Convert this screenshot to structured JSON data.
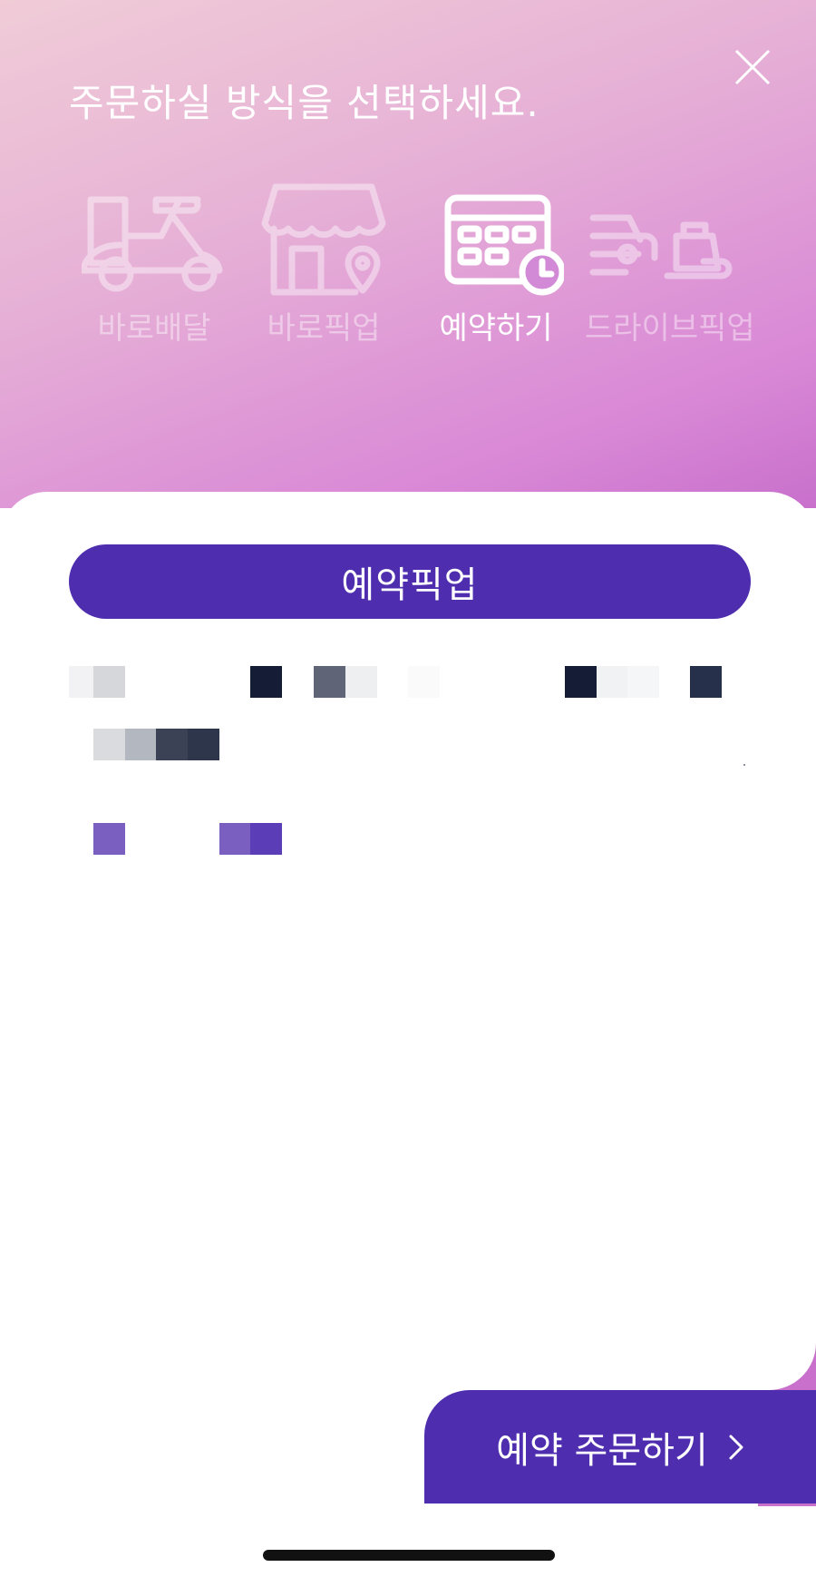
{
  "header": {
    "title": "주문하실 방식을 선택하세요."
  },
  "modes": [
    {
      "label": "바로배달",
      "icon": "scooter-icon",
      "active": false
    },
    {
      "label": "바로픽업",
      "icon": "store-pin-icon",
      "active": false
    },
    {
      "label": "예약하기",
      "icon": "calendar-clock-icon",
      "active": true
    },
    {
      "label": "드라이브픽업",
      "icon": "drive-pickup-icon",
      "active": false
    }
  ],
  "selected_option": {
    "label": "예약픽업"
  },
  "cta": {
    "label": "예약 주문하기",
    "icon": "chevron-right-icon"
  },
  "colors": {
    "accent": "#4e2daf",
    "gradient_start": "#f0ccd7",
    "gradient_end": "#c870cc"
  },
  "content_redacted": true
}
